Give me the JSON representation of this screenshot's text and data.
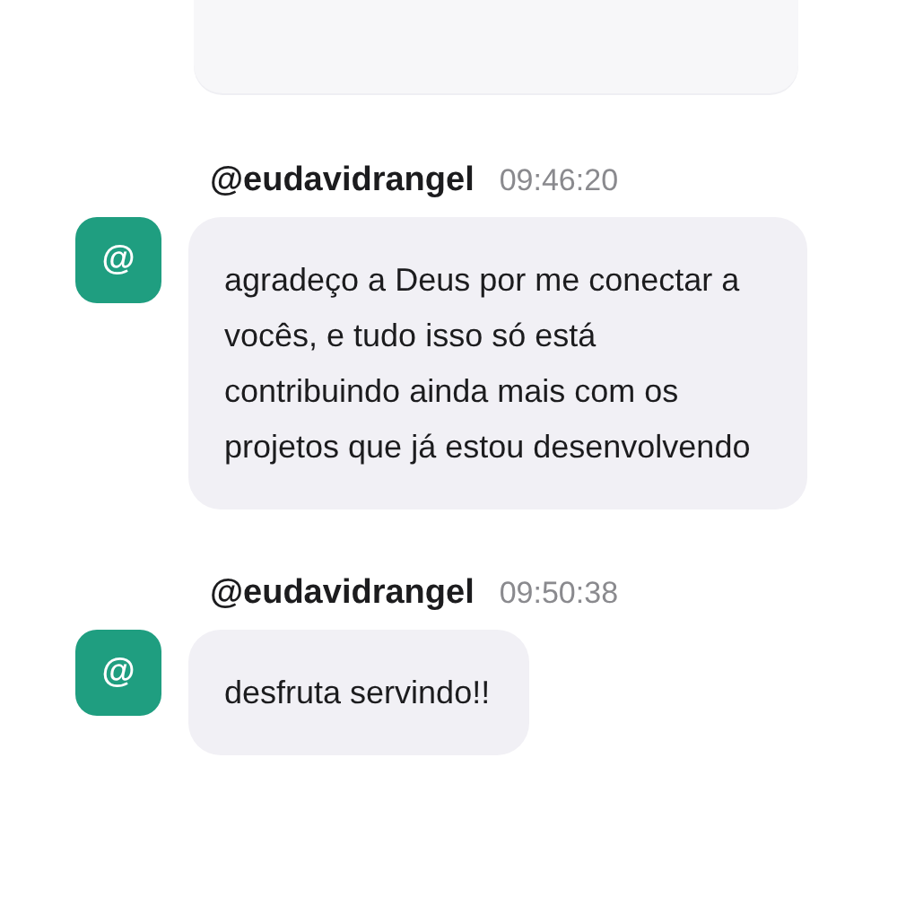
{
  "messages": [
    {
      "username": "@eudavidrangel",
      "time": "09:46:20",
      "avatar": "@",
      "text": "agradeço a Deus por me conectar a vocês, e tudo isso só está contribuindo ainda mais com os projetos que já estou desenvolvendo"
    },
    {
      "username": "@eudavidrangel",
      "time": "09:50:38",
      "avatar": "@",
      "text": "desfruta servindo!!"
    }
  ]
}
